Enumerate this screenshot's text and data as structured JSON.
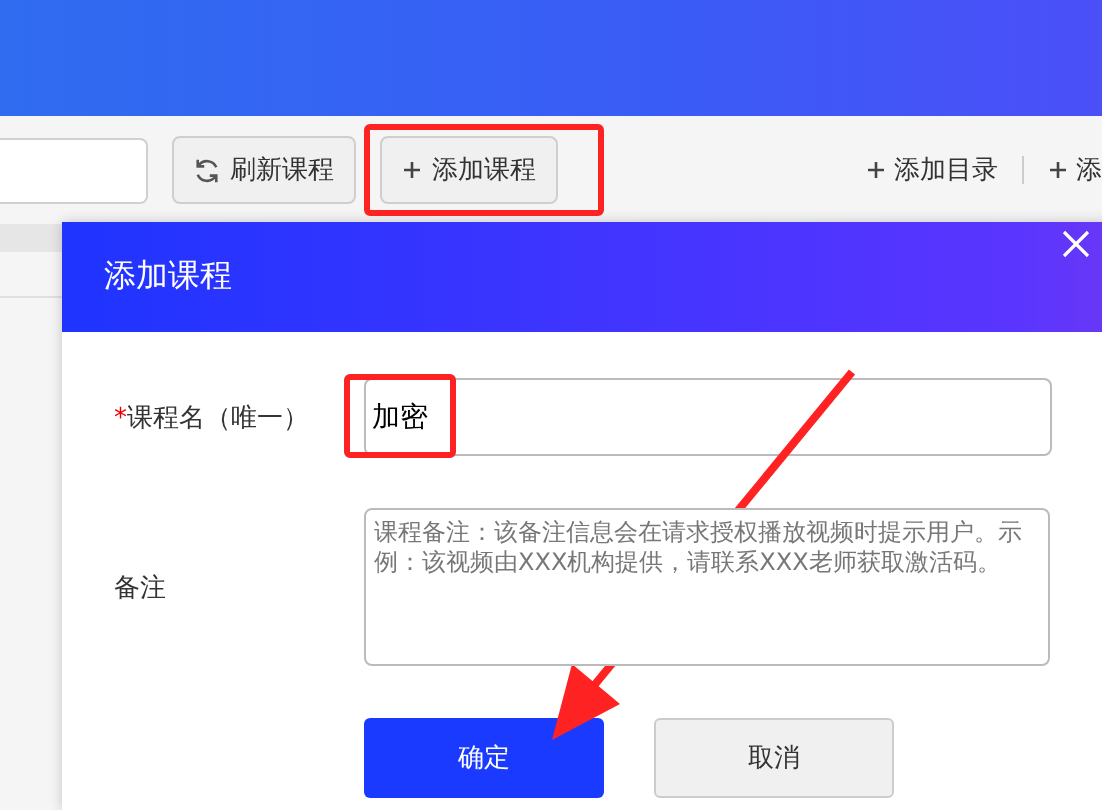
{
  "toolbar": {
    "buttons": [
      {
        "kind": "refresh",
        "label": "刷新课程"
      },
      {
        "kind": "add",
        "label": "添加课程"
      }
    ],
    "actions": [
      "添加目录",
      "添"
    ]
  },
  "dialog": {
    "title": "添加课程",
    "fields": [
      {
        "kind": "input",
        "required_mark": "*",
        "label": "课程名（唯一）",
        "value": "加密"
      },
      {
        "kind": "textarea",
        "label": "备注",
        "placeholder": "课程备注：该备注信息会在请求授权播放视频时提示用户。示例：该视频由XXX机构提供，请联系XXX老师获取激活码。"
      }
    ],
    "buttons": [
      {
        "kind": "primary",
        "label": "确定"
      },
      {
        "kind": "secondary",
        "label": "取消"
      }
    ]
  }
}
